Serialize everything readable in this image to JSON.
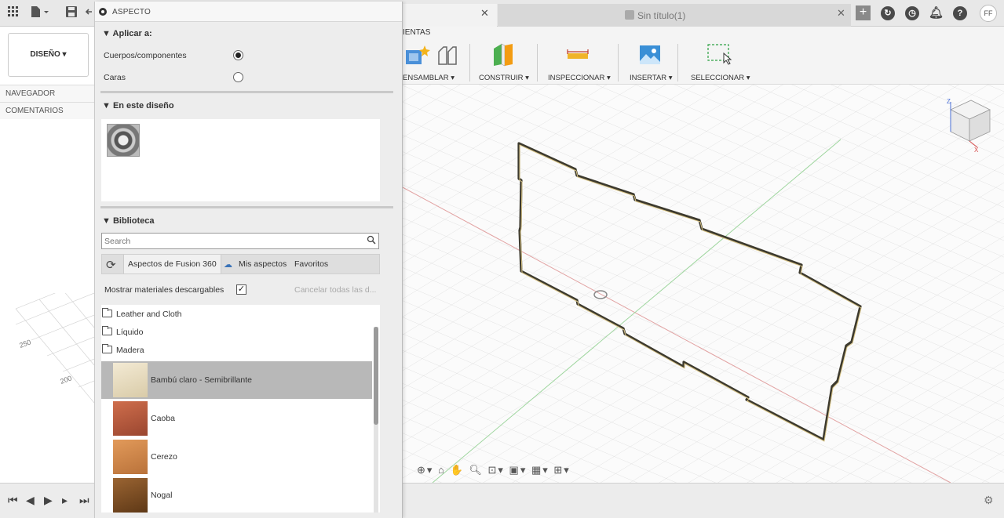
{
  "top_bar": {
    "doc_tab_title": "Sin título(1)",
    "avatar_initials": "FF"
  },
  "browser": {
    "workspace_button": "DISEÑO ▾",
    "navigator_label": "NAVEGADOR",
    "comments_label": "COMENTARIOS"
  },
  "ribbon": {
    "tab_fragment": "IENTAS",
    "groups": {
      "assemble": "ENSAMBLAR ▾",
      "construct": "CONSTRUIR ▾",
      "inspect": "INSPECCIONAR ▾",
      "insert": "INSERTAR ▾",
      "select": "SELECCIONAR ▾"
    }
  },
  "viewcube": {
    "z_label": "Z",
    "x_label": "X"
  },
  "grid_labels": [
    "250",
    "200"
  ],
  "dialog": {
    "title": "ASPECTO",
    "apply_to": {
      "heading": "▼ Aplicar a:",
      "options": [
        {
          "label": "Cuerpos/componentes",
          "selected": true
        },
        {
          "label": "Caras",
          "selected": false
        }
      ]
    },
    "in_design_heading": "▼ En este diseño",
    "library": {
      "heading": "▼ Biblioteca",
      "search_placeholder": "Search",
      "tabs": [
        "Aspectos de Fusion 360",
        "Mis aspectos",
        "Favoritos"
      ],
      "show_downloadable_label": "Mostrar materiales descargables",
      "show_downloadable_checked": true,
      "cancel_all_label": "Cancelar todas las d...",
      "folders": [
        "Leather and Cloth",
        "Líquido",
        "Madera"
      ],
      "materials": [
        {
          "name": "Bambú claro - Semibrillante",
          "selected": true,
          "color": "#e8dcc0"
        },
        {
          "name": "Caoba",
          "selected": false,
          "color": "#b5583a"
        },
        {
          "name": "Cerezo",
          "selected": false,
          "color": "#d2874a"
        },
        {
          "name": "Nogal",
          "selected": false,
          "color": "#7a4a22"
        }
      ]
    }
  }
}
